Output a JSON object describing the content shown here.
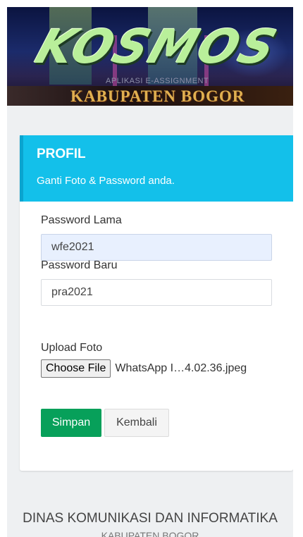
{
  "banner": {
    "logo_text": "KOSMOS",
    "subtitle": "APLIKASI E-ASSIGNMENT",
    "region": "KABUPATEN BOGOR"
  },
  "profile": {
    "title": "PROFIL",
    "subtitle": "Ganti Foto & Password anda.",
    "accent_color": "#13c0ea"
  },
  "form": {
    "old_password_label": "Password Lama",
    "old_password_value": "wfe2021",
    "new_password_label": "Password Baru",
    "new_password_value": "pra2021",
    "upload_label": "Upload Foto",
    "choose_file_label": "Choose File",
    "file_name": "WhatsApp I…4.02.36.jpeg",
    "save_label": "Simpan",
    "back_label": "Kembali",
    "save_color": "#07a05a"
  },
  "footer": {
    "org": "DINAS KOMUNIKASI DAN INFORMATIKA",
    "region": "KABUPATEN BOGOR"
  }
}
